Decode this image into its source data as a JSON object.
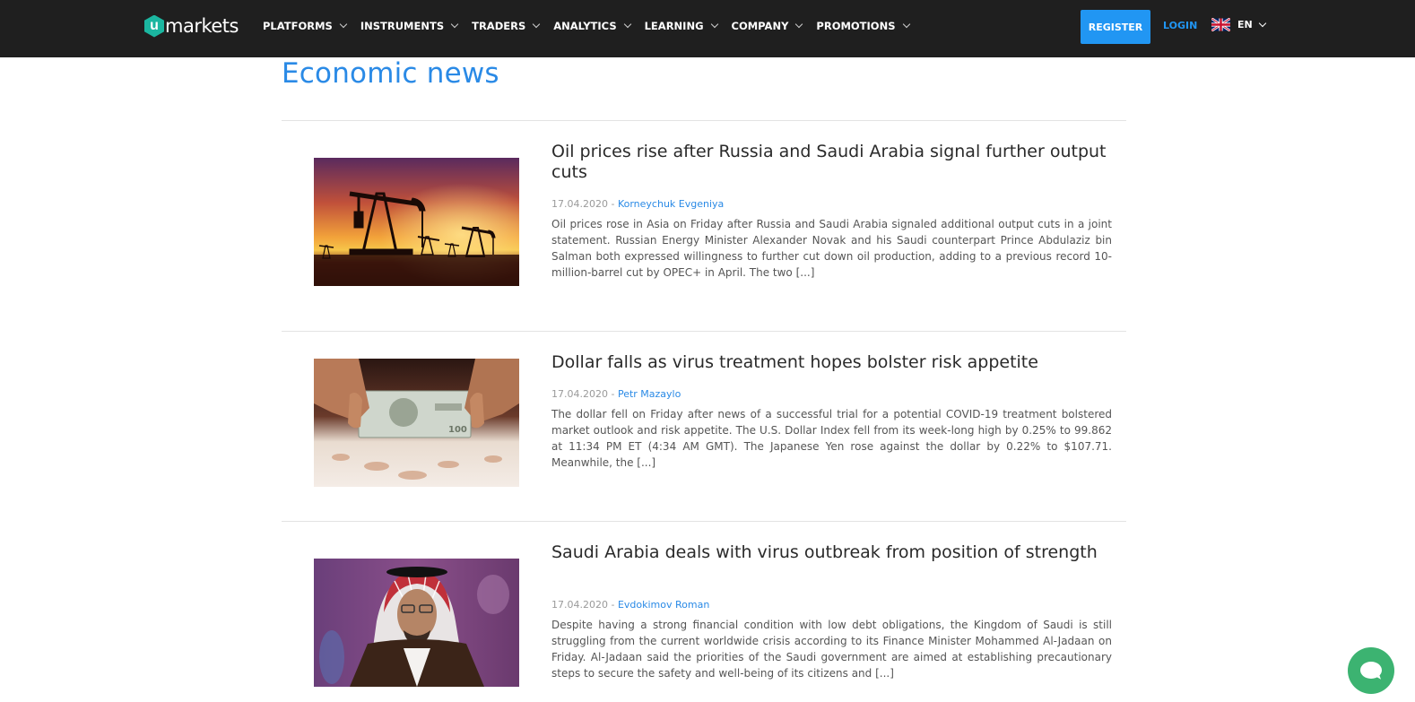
{
  "header": {
    "logo_mark": "u",
    "logo_text": "markets",
    "nav": [
      {
        "label": "PLATFORMS"
      },
      {
        "label": "INSTRUMENTS"
      },
      {
        "label": "TRADERS"
      },
      {
        "label": "ANALYTICS"
      },
      {
        "label": "LEARNING"
      },
      {
        "label": "COMPANY"
      },
      {
        "label": "PROMOTIONS"
      }
    ],
    "register_label": "REGISTER",
    "login_label": "LOGIN",
    "language": "EN",
    "language_icon": "uk-flag-icon"
  },
  "main": {
    "title": "Economic news",
    "articles": [
      {
        "title": "Oil prices rise after Russia and Saudi Arabia signal further output cuts",
        "date": "17.04.2020 - ",
        "author": "Korneychuk Evgeniya",
        "excerpt": "Oil prices rose in Asia on Friday after Russia and Saudi Arabia signaled additional output cuts in a joint statement. Russian Energy Minister Alexander Novak and his Saudi counterpart Prince Abdulaziz bin Salman both expressed willingness to further cut down oil production, adding to a previous record 10-million-barrel cut by OPEC+ in April.  The two [...]",
        "image": "oil-pumpjacks-sunset-image"
      },
      {
        "title": "Dollar falls as virus treatment hopes bolster risk appetite",
        "date": "17.04.2020 - ",
        "author": "Petr Mazaylo",
        "excerpt": "The dollar fell on Friday after news of a successful trial for a potential COVID-19 treatment bolstered market outlook and risk appetite. The U.S. Dollar Index fell from its week-long high by 0.25% to 99.862 at 11:34 PM ET (4:34 AM GMT). The Japanese Yen rose against the dollar by 0.22% to $107.71. Meanwhile, the [...]",
        "image": "hands-holding-dollar-bill-image"
      },
      {
        "title": "Saudi Arabia deals with virus outbreak from position of strength",
        "date": "17.04.2020 - ",
        "author": "Evdokimov Roman",
        "excerpt": "Despite having a strong financial condition with low debt obligations, the Kingdom of Saudi is still struggling from the current worldwide crisis according to its Finance Minister Mohammed Al-Jadaan on Friday. Al-Jadaan said the priorities of the Saudi government are aimed at establishing precautionary steps to secure the safety and well-being of its citizens and [...]",
        "image": "saudi-official-portrait-image"
      }
    ]
  },
  "chat": {
    "icon": "chat-bubble-icon"
  },
  "colors": {
    "topbar": "#1f1f1f",
    "accent": "#2196f3",
    "title_blue": "#2a8ae6",
    "chat_green": "#3cb371"
  }
}
